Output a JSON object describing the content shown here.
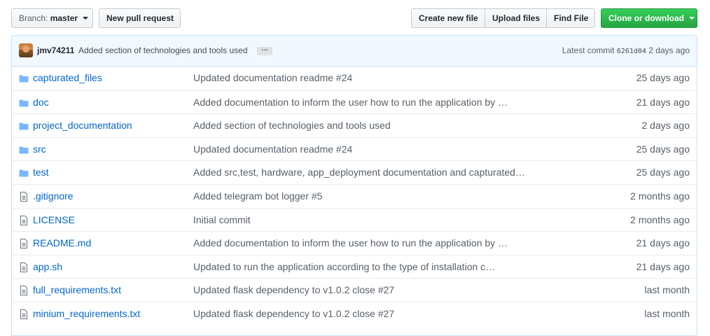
{
  "toolbar": {
    "branch_prefix": "Branch:",
    "branch_name": "master",
    "new_pull_request": "New pull request",
    "create_new_file": "Create new file",
    "upload_files": "Upload files",
    "find_file": "Find File",
    "clone_or_download": "Clone or download"
  },
  "commit": {
    "author": "jmv74211",
    "message": "Added section of technologies and tools used",
    "ellipsis": "…",
    "latest_label": "Latest commit",
    "sha": "6261d04",
    "age": "2 days ago"
  },
  "colors": {
    "link": "#0366d6",
    "clone_green": "#28a745",
    "commit_bar_bg": "#f1f8ff",
    "folder_icon": "#79b8ff",
    "file_icon": "#6a737d"
  },
  "files": [
    {
      "type": "folder",
      "icon": "folder-icon",
      "name": "capturated_files",
      "message": "Updated documentation readme #24",
      "age": "25 days ago"
    },
    {
      "type": "folder",
      "icon": "folder-icon",
      "name": "doc",
      "message": "Added documentation to inform the user how to run the application by …",
      "age": "21 days ago"
    },
    {
      "type": "folder",
      "icon": "folder-icon",
      "name": "project_documentation",
      "message": "Added section of technologies and tools used",
      "age": "2 days ago"
    },
    {
      "type": "folder",
      "icon": "folder-icon",
      "name": "src",
      "message": "Updated documentation readme #24",
      "age": "25 days ago"
    },
    {
      "type": "folder",
      "icon": "folder-icon",
      "name": "test",
      "message": "Added src,test, hardware, app_deployment documentation and capturated…",
      "age": "25 days ago"
    },
    {
      "type": "file",
      "icon": "file-icon",
      "name": ".gitignore",
      "message": "Added telegram bot logger #5",
      "age": "2 months ago"
    },
    {
      "type": "file",
      "icon": "file-icon",
      "name": "LICENSE",
      "message": "Initial commit",
      "age": "2 months ago"
    },
    {
      "type": "file",
      "icon": "file-icon",
      "name": "README.md",
      "message": "Added documentation to inform the user how to run the application by …",
      "age": "21 days ago"
    },
    {
      "type": "file",
      "icon": "file-icon",
      "name": "app.sh",
      "message": "Updated to run the application according to the type of installation c…",
      "age": "21 days ago"
    },
    {
      "type": "file",
      "icon": "file-icon",
      "name": "full_requirements.txt",
      "message": "Updated flask dependency to v1.0.2 close #27",
      "age": "last month"
    },
    {
      "type": "file",
      "icon": "file-icon",
      "name": "minium_requirements.txt",
      "message": "Updated flask dependency to v1.0.2 close #27",
      "age": "last month"
    }
  ]
}
